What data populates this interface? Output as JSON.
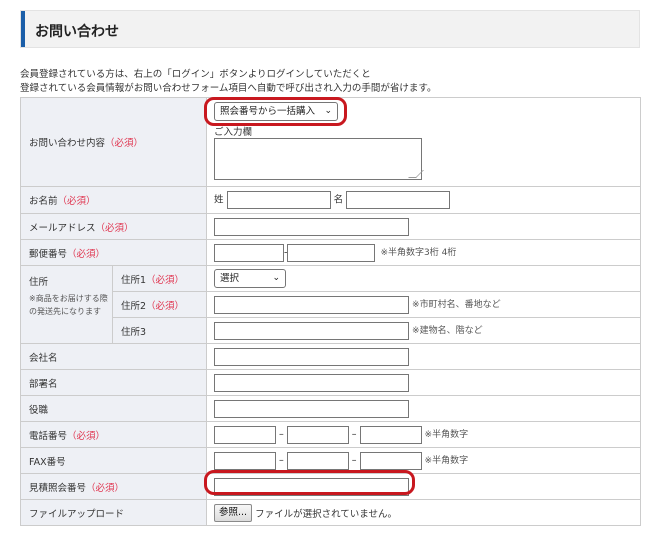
{
  "header": {
    "title": "お問い合わせ"
  },
  "intro": {
    "line1": "会員登録されている方は、右上の「ログイン」ボタンよりログインしていただくと",
    "line2": "登録されている会員情報がお問い合わせフォーム項目へ自動で呼び出され入力の手間が省けます。"
  },
  "required_mark": "（必須）",
  "form": {
    "inquiry": {
      "label": "お問い合わせ内容",
      "select_value": "照会番号から一括購入",
      "sub_label": "ご入力欄"
    },
    "name": {
      "label": "お名前",
      "last_label": "姓",
      "first_label": "名"
    },
    "email": {
      "label": "メールアドレス"
    },
    "postal": {
      "label": "郵便番号",
      "sep": "-",
      "note": "※半角数字3桁 4桁"
    },
    "address": {
      "label": "住所",
      "note": "※商品をお届けする際の発送先になります",
      "addr1": {
        "label": "住所1",
        "select_value": "選択"
      },
      "addr2": {
        "label": "住所2",
        "note": "※市町村名、番地など"
      },
      "addr3": {
        "label": "住所3",
        "note": "※建物名、階など"
      }
    },
    "company": {
      "label": "会社名"
    },
    "department": {
      "label": "部署名"
    },
    "position": {
      "label": "役職"
    },
    "phone": {
      "label": "電話番号",
      "sep": "–",
      "note": "※半角数字"
    },
    "fax": {
      "label": "FAX番号",
      "sep": "–",
      "note": "※半角数字"
    },
    "quote": {
      "label": "見積照会番号"
    },
    "upload": {
      "label": "ファイルアップロード",
      "button": "参照...",
      "status": "ファイルが選択されていません。"
    }
  },
  "colors": {
    "accent": "#1a5ea8",
    "required": "#e0344f",
    "highlight": "#c8181f",
    "label_bg": "#eef0f5"
  }
}
